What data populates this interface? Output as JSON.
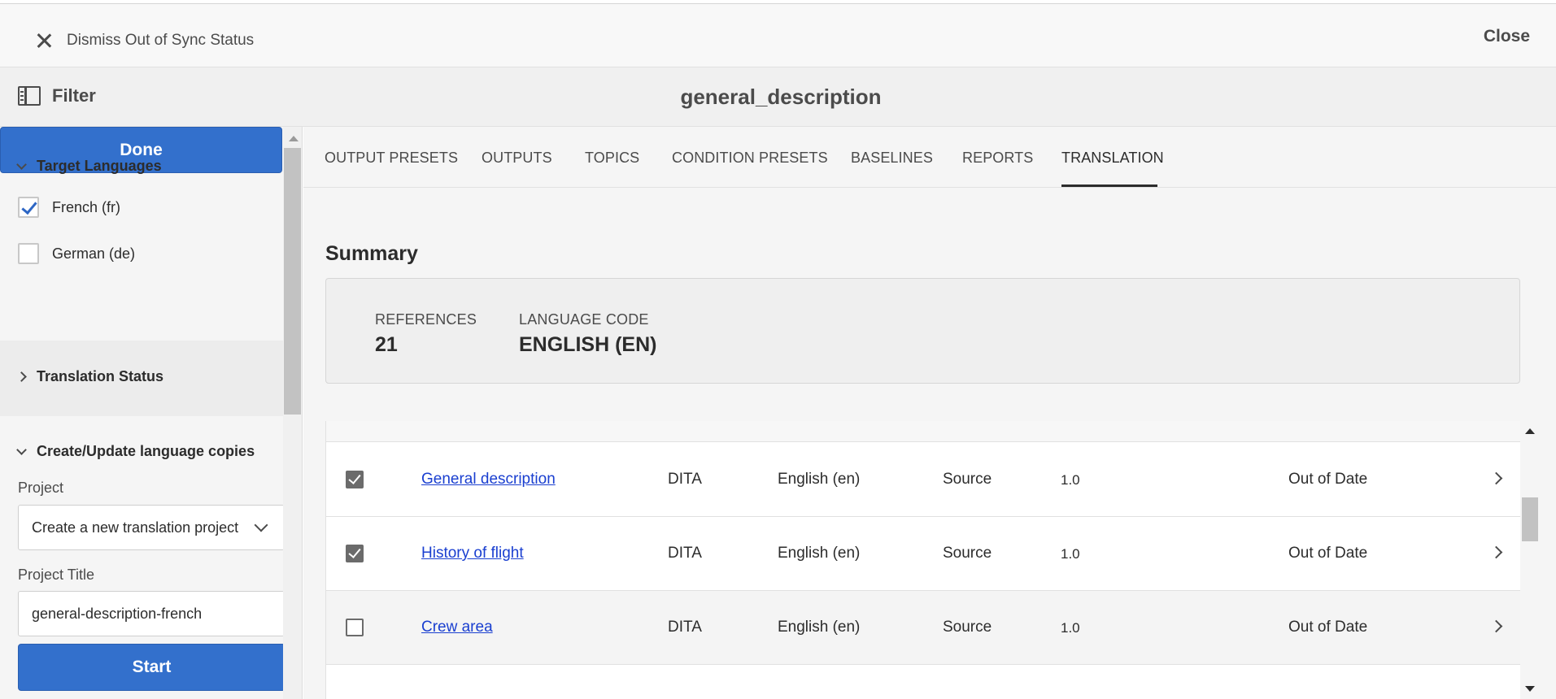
{
  "actionbar": {
    "dismiss_label": "Dismiss Out of Sync Status",
    "close_label": "Close"
  },
  "titlebar": {
    "filter_label": "Filter",
    "document_title": "general_description"
  },
  "sidebar": {
    "done_label": "Done",
    "target_languages": {
      "heading": "Target Languages",
      "options": [
        {
          "label": "French (fr)",
          "checked": true
        },
        {
          "label": "German (de)",
          "checked": false
        }
      ]
    },
    "translation_status_heading": "Translation Status",
    "create_update": {
      "heading": "Create/Update language copies",
      "project_label": "Project",
      "project_value": "Create a new translation project",
      "project_title_label": "Project Title",
      "project_title_value": "general-description-french",
      "start_label": "Start"
    }
  },
  "tabs": [
    {
      "label": "OUTPUT PRESETS",
      "active": false
    },
    {
      "label": "OUTPUTS",
      "active": false
    },
    {
      "label": "TOPICS",
      "active": false
    },
    {
      "label": "CONDITION PRESETS",
      "active": false
    },
    {
      "label": "BASELINES",
      "active": false
    },
    {
      "label": "REPORTS",
      "active": false
    },
    {
      "label": "TRANSLATION",
      "active": true
    }
  ],
  "summary": {
    "title": "Summary",
    "references_label": "REFERENCES",
    "references_value": "21",
    "language_code_label": "LANGUAGE CODE",
    "language_code_value": "ENGLISH (EN)"
  },
  "rows": [
    {
      "checked": true,
      "title": "General description",
      "type": "DITA",
      "language": "English (en)",
      "role": "Source",
      "version": "1.0",
      "status": "Out of Date"
    },
    {
      "checked": true,
      "title": "History of flight",
      "type": "DITA",
      "language": "English (en)",
      "role": "Source",
      "version": "1.0",
      "status": "Out of Date"
    },
    {
      "checked": false,
      "title": "Crew area",
      "type": "DITA",
      "language": "English (en)",
      "role": "Source",
      "version": "1.0",
      "status": "Out of Date"
    }
  ],
  "icons": [
    "close-icon",
    "filter-panel-icon",
    "chevron-down-icon",
    "chevron-right-icon",
    "checkbox-icon",
    "row-arrow-icon"
  ]
}
